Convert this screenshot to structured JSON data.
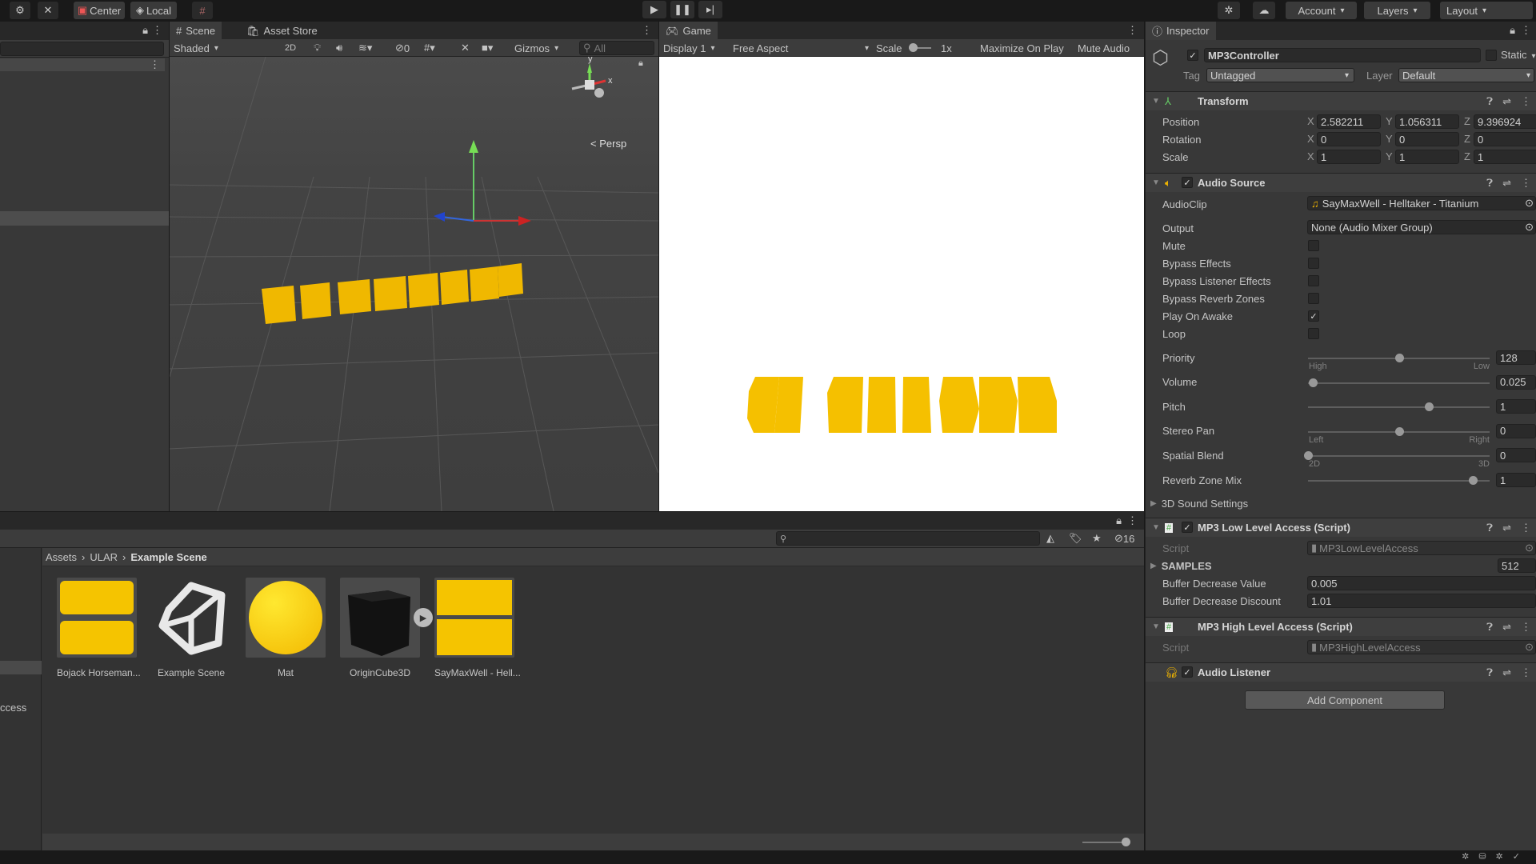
{
  "toolbar": {
    "center": "Center",
    "local": "Local",
    "account": "Account",
    "layers": "Layers",
    "layout": "Layout"
  },
  "scene": {
    "tab": "Scene",
    "asset_store_tab": "Asset Store",
    "shading": "Shaded",
    "mode_2d": "2D",
    "hidden_count": "0",
    "gizmos": "Gizmos",
    "search_placeholder": "All",
    "persp": "Persp",
    "axis_x": "x",
    "axis_y": "y"
  },
  "game": {
    "tab": "Game",
    "display": "Display 1",
    "aspect": "Free Aspect",
    "scale_label": "Scale",
    "scale_value": "1x",
    "maximize": "Maximize On Play",
    "mute": "Mute Audio"
  },
  "inspector": {
    "tab": "Inspector",
    "object_name": "MP3Controller",
    "active": true,
    "static_label": "Static",
    "tag_label": "Tag",
    "tag": "Untagged",
    "layer_label": "Layer",
    "layer": "Default",
    "transform": {
      "title": "Transform",
      "rows": [
        {
          "label": "Position",
          "x": "2.582211",
          "y": "1.056311",
          "z": "9.396924"
        },
        {
          "label": "Rotation",
          "x": "0",
          "y": "0",
          "z": "0"
        },
        {
          "label": "Scale",
          "x": "1",
          "y": "1",
          "z": "1"
        }
      ]
    },
    "audio_source": {
      "title": "Audio Source",
      "enabled": true,
      "audioclip_label": "AudioClip",
      "audioclip": "SayMaxWell - Helltaker - Titanium",
      "output_label": "Output",
      "output": "None (Audio Mixer Group)",
      "toggles": [
        {
          "label": "Mute",
          "checked": false
        },
        {
          "label": "Bypass Effects",
          "checked": false
        },
        {
          "label": "Bypass Listener Effects",
          "checked": false
        },
        {
          "label": "Bypass Reverb Zones",
          "checked": false
        },
        {
          "label": "Play On Awake",
          "checked": true
        },
        {
          "label": "Loop",
          "checked": false
        }
      ],
      "sliders": [
        {
          "label": "Priority",
          "value": "128",
          "fraction": 0.5,
          "min_label": "High",
          "max_label": "Low"
        },
        {
          "label": "Volume",
          "value": "0.025",
          "fraction": 0.025
        },
        {
          "label": "Pitch",
          "value": "1",
          "fraction": 0.667
        },
        {
          "label": "Stereo Pan",
          "value": "0",
          "fraction": 0.5,
          "min_label": "Left",
          "max_label": "Right"
        },
        {
          "label": "Spatial Blend",
          "value": "0",
          "fraction": 0,
          "min_label": "2D",
          "max_label": "3D"
        },
        {
          "label": "Reverb Zone Mix",
          "value": "1",
          "fraction": 0.909
        }
      ],
      "sound_settings": "3D Sound Settings"
    },
    "low_level": {
      "title": "MP3 Low Level Access (Script)",
      "enabled": true,
      "script_label": "Script",
      "script": "MP3LowLevelAccess",
      "samples_label": "SAMPLES",
      "samples": "512",
      "buffer_value_label": "Buffer Decrease Value",
      "buffer_value": "0.005",
      "buffer_discount_label": "Buffer Decrease Discount",
      "buffer_discount": "1.01"
    },
    "high_level": {
      "title": "MP3 High Level Access (Script)",
      "script_label": "Script",
      "script": "MP3HighLevelAccess"
    },
    "listener": {
      "title": "Audio Listener",
      "enabled": true
    },
    "add_component": "Add Component"
  },
  "project": {
    "breadcrumb": [
      "Assets",
      "ULAR",
      "Example Scene"
    ],
    "hidden_count": "16",
    "left_truncated": "ccess",
    "assets": [
      {
        "name": "Bojack Horseman..."
      },
      {
        "name": "Example Scene"
      },
      {
        "name": "Mat"
      },
      {
        "name": "OriginCube3D"
      },
      {
        "name": "SayMaxWell - Hell..."
      }
    ]
  },
  "colors": {
    "accent_yellow": "#f5c400",
    "game_bg": "#ffffff",
    "panel": "#383838"
  }
}
